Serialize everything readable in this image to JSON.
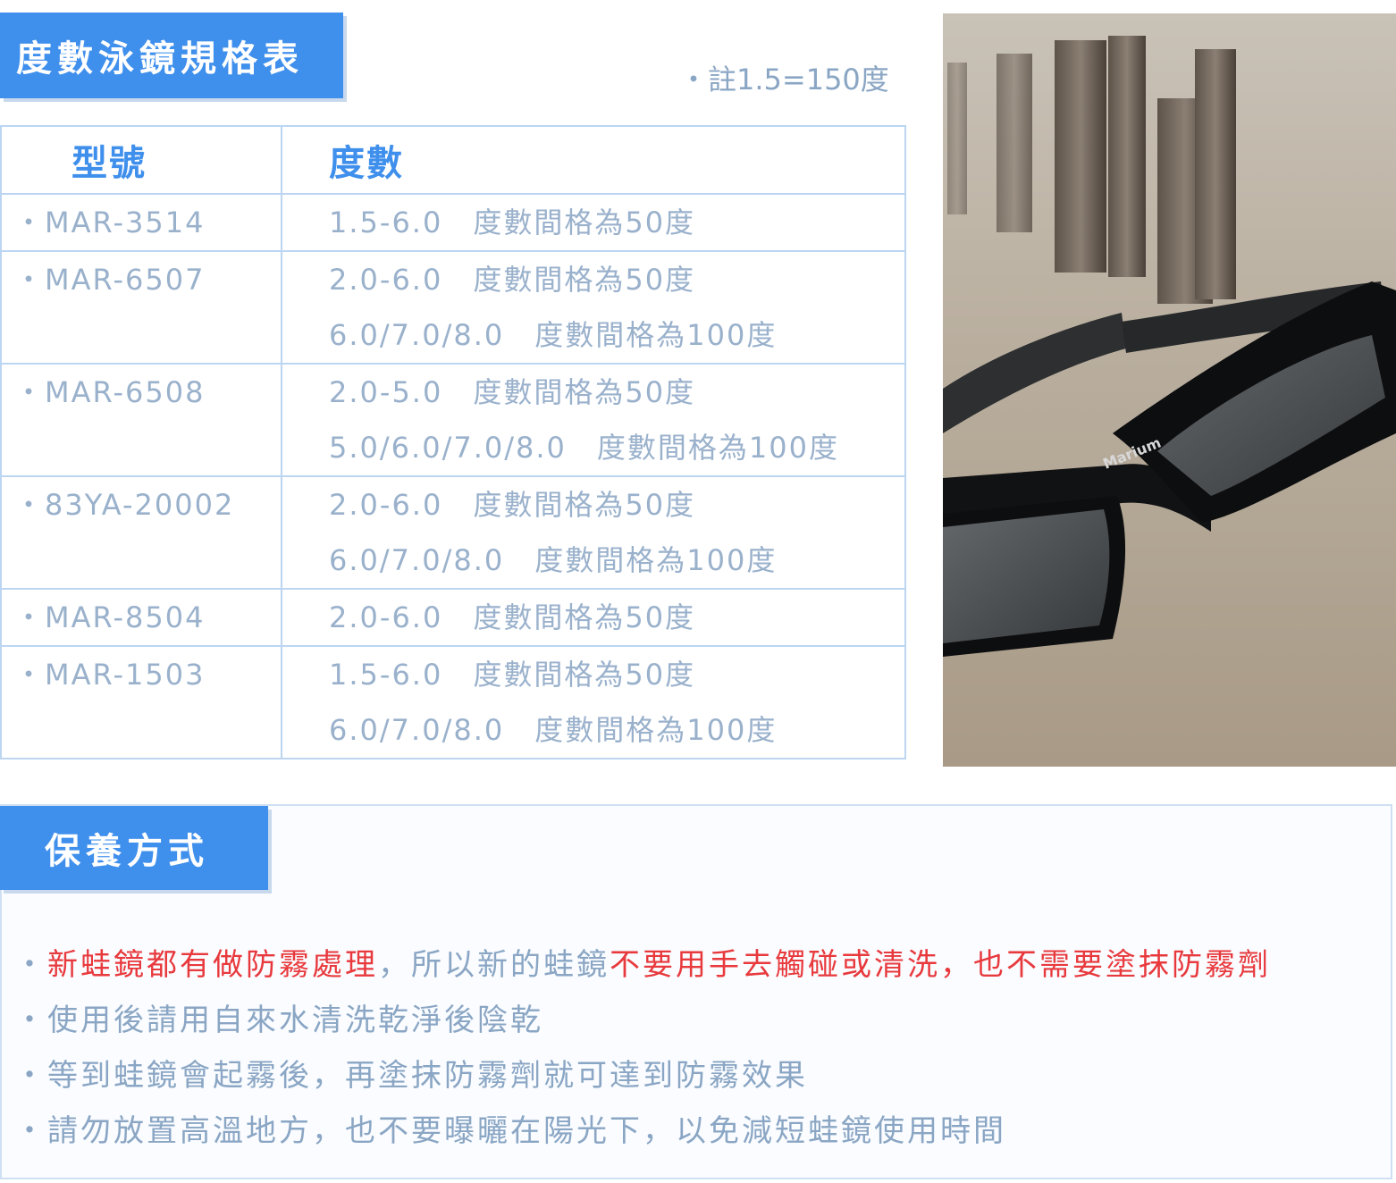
{
  "spec": {
    "title": "度數泳鏡規格表",
    "note": "・註1.5=150度",
    "header_model": "型號",
    "header_degree": "度數",
    "rows": [
      {
        "model": "・MAR-3514",
        "lines": [
          "1.5-6.0　度數間格為50度"
        ]
      },
      {
        "model": "・MAR-6507",
        "lines": [
          "2.0-6.0　度數間格為50度",
          "6.0/7.0/8.0　度數間格為100度"
        ]
      },
      {
        "model": "・MAR-6508",
        "lines": [
          "2.0-5.0　度數間格為50度",
          "5.0/6.0/7.0/8.0　度數間格為100度"
        ]
      },
      {
        "model": "・83YA-20002",
        "lines": [
          "2.0-6.0　度數間格為50度",
          "6.0/7.0/8.0　度數間格為100度"
        ]
      },
      {
        "model": "・MAR-8504",
        "lines": [
          "2.0-6.0　度數間格為50度"
        ]
      },
      {
        "model": "・MAR-1503",
        "lines": [
          "1.5-6.0　度數間格為50度",
          "6.0/7.0/8.0　度數間格為100度"
        ]
      }
    ]
  },
  "photo": {
    "logo_text": "Marium"
  },
  "care": {
    "title": "保養方式",
    "item1_a": "・",
    "item1_b": "新蛙鏡都有做防霧處理",
    "item1_c": "，所以新的蛙鏡",
    "item1_d": "不要用手去觸碰或清洗，也不需要塗抹防霧劑",
    "item2": "・使用後請用自來水清洗乾淨後陰乾",
    "item3": "・等到蛙鏡會起霧後，再塗抹防霧劑就可達到防霧效果",
    "item4": "・請勿放置高溫地方，也不要曝曬在陽光下，以免減短蛙鏡使用時間"
  },
  "colors": {
    "accent": "#3f8fec",
    "text": "#8aa6c4",
    "warning": "#e8393d",
    "border": "#bcd6f2"
  }
}
